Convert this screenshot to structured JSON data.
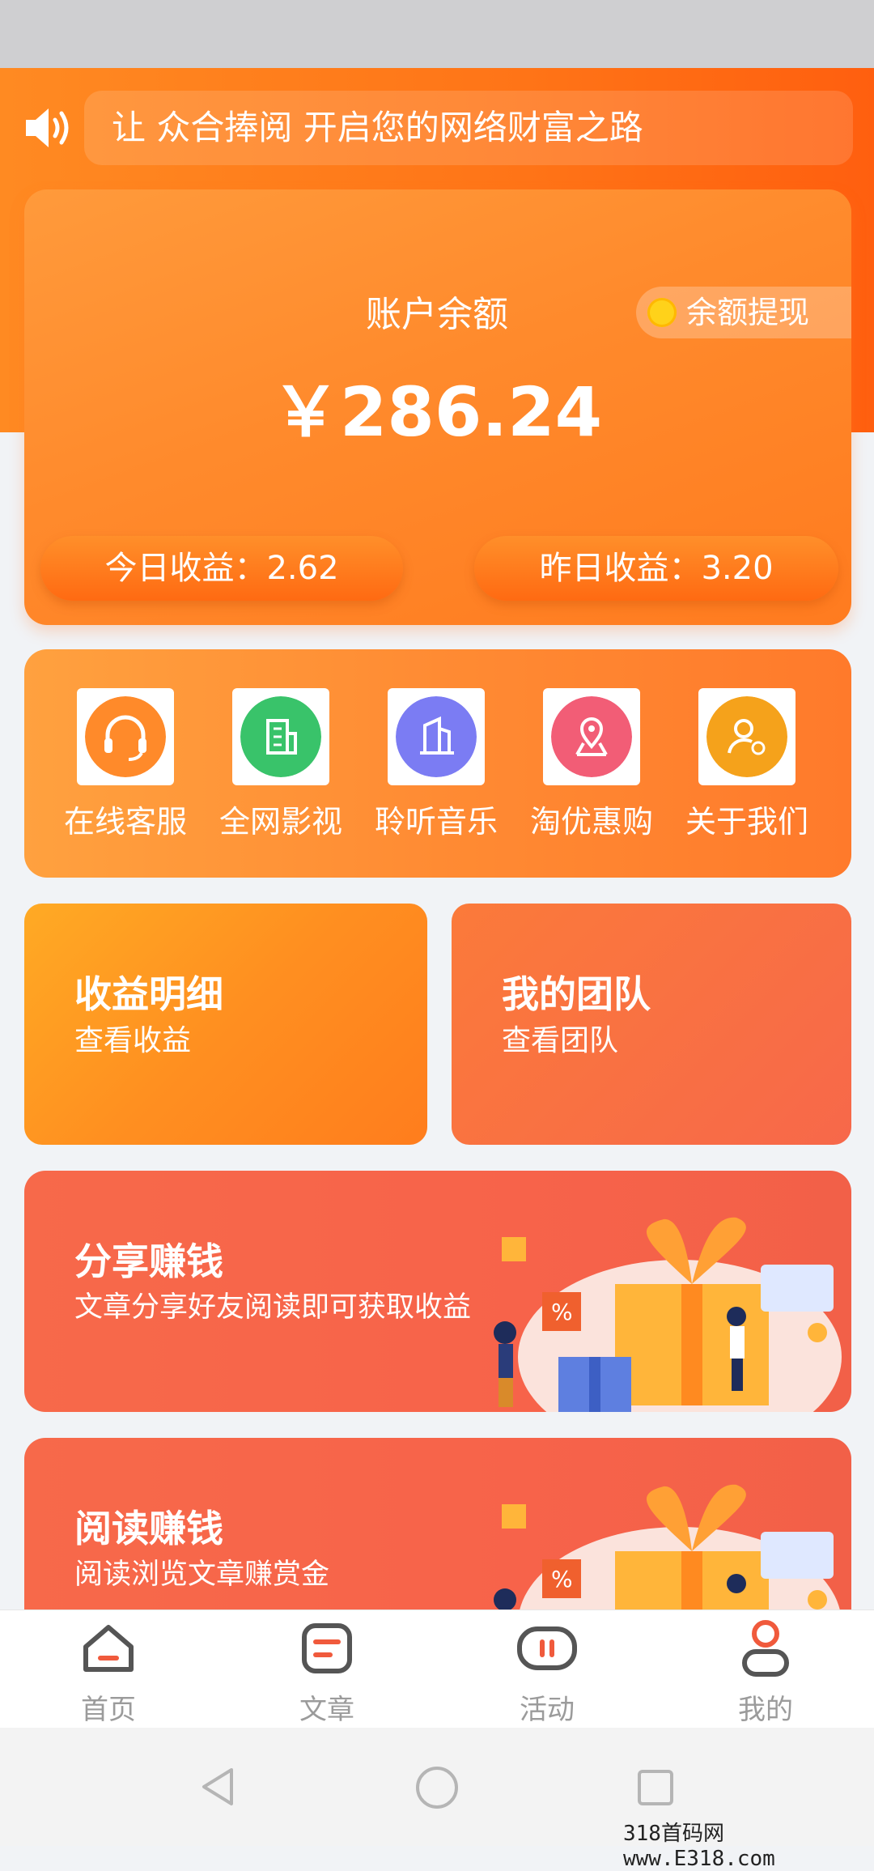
{
  "notice": {
    "text": "让 众合捧阅 开启您的网络财富之路"
  },
  "balance": {
    "label": "账户余额",
    "amount": "￥286.24",
    "withdraw_label": "余额提现"
  },
  "earnings": {
    "today": "今日收益：2.62",
    "yesterday": "昨日收益：3.20"
  },
  "menu": [
    {
      "label": "在线客服",
      "icon": "headset-icon",
      "color": "#ff8a2a"
    },
    {
      "label": "全网影视",
      "icon": "building-icon",
      "color": "#39c36a"
    },
    {
      "label": "聆听音乐",
      "icon": "tower-icon",
      "color": "#7b7cf3"
    },
    {
      "label": "淘优惠购",
      "icon": "location-pin-icon",
      "color": "#f25d76"
    },
    {
      "label": "关于我们",
      "icon": "user-location-icon",
      "color": "#f5a21b"
    }
  ],
  "tiles": {
    "income": {
      "title": "收益明细",
      "subtitle": "查看收益"
    },
    "team": {
      "title": "我的团队",
      "subtitle": "查看团队"
    }
  },
  "promos": [
    {
      "title": "分享赚钱",
      "subtitle": "文章分享好友阅读即可获取收益"
    },
    {
      "title": "阅读赚钱",
      "subtitle": "阅读浏览文章赚赏金"
    }
  ],
  "tabs": [
    {
      "label": "首页",
      "icon": "home-icon"
    },
    {
      "label": "文章",
      "icon": "article-icon"
    },
    {
      "label": "活动",
      "icon": "activity-icon"
    },
    {
      "label": "我的",
      "icon": "profile-icon"
    }
  ],
  "watermark": "318首码网 www.E318.com",
  "colors": {
    "accent": "#ff7a1f",
    "promo": "#f7694a",
    "tab_active": "#f05a3c"
  }
}
